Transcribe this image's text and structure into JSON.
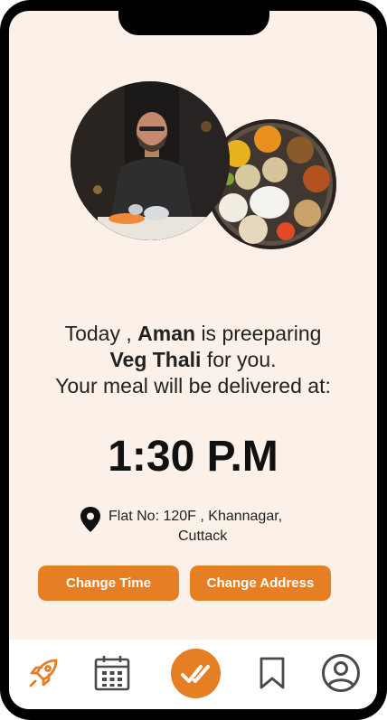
{
  "message": {
    "line1_prefix": "Today ,",
    "chef_name": "Aman",
    "line1_suffix": "is preeparing",
    "dish": "Veg Thali",
    "line2_suffix": "for you.",
    "line3": "Your meal will be delivered at:"
  },
  "delivery": {
    "time": "1:30 P.M",
    "address_line1": "Flat  No: 120F , Khannagar,",
    "address_line2": "Cuttack"
  },
  "buttons": {
    "change_time": "Change Time",
    "change_address": "Change Address"
  },
  "nav": {
    "items": [
      "rocket-icon",
      "calendar-icon",
      "double-check-icon",
      "bookmark-icon",
      "profile-icon"
    ],
    "active": "double-check-icon"
  },
  "colors": {
    "accent": "#e67f24",
    "background": "#fbf1e9",
    "nav_icon": "#4a4a4a"
  }
}
